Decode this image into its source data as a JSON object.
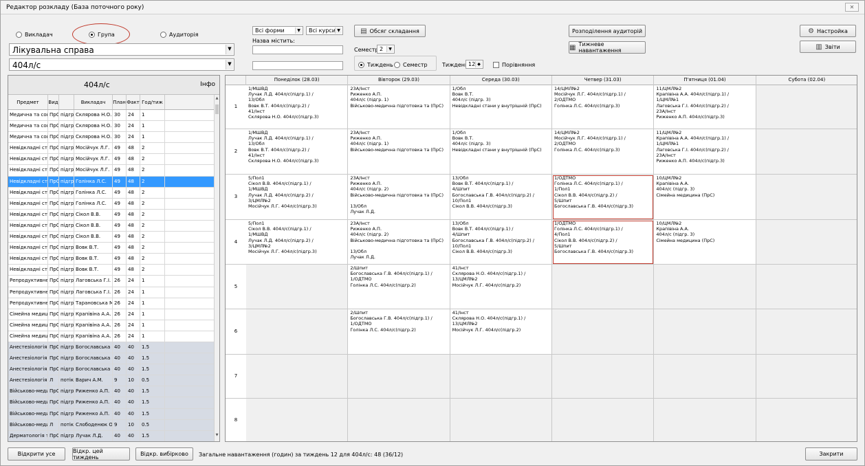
{
  "window": {
    "title": "Редактор розкладу (База поточного року)",
    "close_glyph": "✕"
  },
  "mode": {
    "options": [
      "Викладач",
      "Група",
      "Аудиторія"
    ],
    "selected": "Група"
  },
  "specialty_combo": {
    "value": "Лікувальна справа"
  },
  "group_combo": {
    "value": "404л/с"
  },
  "filters": {
    "forms": "Всі форми",
    "courses": "Всі курси",
    "city_label": "Назва містить:",
    "city_value": "",
    "second_value": ""
  },
  "buttons": {
    "volume": "Обсяг складання",
    "distribution": "Розподілення аудиторій",
    "weekly_load": "Тижневе навантаження",
    "settings": "Настройка",
    "reports": "Звіти",
    "open_all": "Відкрити усе",
    "open_week": "Відкр. цей тиждень",
    "open_selective": "Відкр. вибірково",
    "close": "Закрити"
  },
  "semester": {
    "label": "Семестр",
    "value": "2"
  },
  "view": {
    "week_label": "Тиждень",
    "semester_label": "Семестр",
    "selected": "Тиждень",
    "week_num_label": "Тиждень",
    "week_num": "12",
    "compare_label": "Порівняння"
  },
  "left_table": {
    "group": "404л/с",
    "info": "Інфо",
    "headers": [
      "Предмет",
      "Вид",
      "",
      "Викладач",
      "План",
      "Факт",
      "Год/тиж"
    ],
    "rows": [
      [
        "Медична та соціальна р",
        "ПрС",
        "підгр. 1",
        "Склярова Н.О.",
        "30",
        "24",
        "1"
      ],
      [
        "Медична та соціальна р",
        "ПрС",
        "підгр. 2",
        "Склярова Н.О.",
        "30",
        "24",
        "1"
      ],
      [
        "Медична та соціальна р",
        "ПрС",
        "підгр. 3",
        "Склярова Н.О.",
        "30",
        "24",
        "1"
      ],
      [
        "Невідкладні стани в ак",
        "ПрС",
        "підгр. 1",
        "Мосійчук Л.Г.",
        "49",
        "48",
        "2"
      ],
      [
        "Невідкладні стани в ак",
        "ПрС",
        "підгр. 2",
        "Мосійчук Л.Г.",
        "49",
        "48",
        "2"
      ],
      [
        "Невідкладні стани в ак",
        "ПрС",
        "підгр. 3",
        "Мосійчук Л.Г.",
        "49",
        "48",
        "2"
      ],
      [
        "Невідкладні стани в пе",
        "ПрС",
        "підгр. 1",
        "Голінка Л.С.",
        "49",
        "48",
        "2"
      ],
      [
        "Невідкладні стани в пе",
        "ПрС",
        "підгр. 2",
        "Голінка Л.С.",
        "49",
        "48",
        "2"
      ],
      [
        "Невідкладні стани в пе",
        "ПрС",
        "підгр. 3",
        "Голінка Л.С.",
        "49",
        "48",
        "2"
      ],
      [
        "Невідкладні стани в хір",
        "ПрС",
        "підгр. 1",
        "Сікол В.В.",
        "49",
        "48",
        "2"
      ],
      [
        "Невідкладні стани в хір",
        "ПрС",
        "підгр. 2",
        "Сікол В.В.",
        "49",
        "48",
        "2"
      ],
      [
        "Невідкладні стани в хір",
        "ПрС",
        "підгр. 3",
        "Сікол В.В.",
        "49",
        "48",
        "2"
      ],
      [
        "Невідкладні стани у вну",
        "ПрС",
        "підгр. 1",
        "Вовк В.Т.",
        "49",
        "48",
        "2"
      ],
      [
        "Невідкладні стани у вну",
        "ПрС",
        "підгр. 2",
        "Вовк В.Т.",
        "49",
        "48",
        "2"
      ],
      [
        "Невідкладні стани у вну",
        "ПрС",
        "підгр. 3",
        "Вовк В.Т.",
        "49",
        "48",
        "2"
      ],
      [
        "Репродуктивне здоров",
        "ПрС",
        "підгр. 2",
        "Лаговська Г.І.",
        "26",
        "24",
        "1"
      ],
      [
        "Репродуктивне здоров",
        "ПрС",
        "підгр. 3",
        "Лаговська Г.І.",
        "26",
        "24",
        "1"
      ],
      [
        "Репродуктивне здоров",
        "ПрС",
        "підгр. 1",
        "Тарановська М.І.",
        "26",
        "24",
        "1"
      ],
      [
        "Сімейна медицина",
        "ПрС",
        "підгр. 1",
        "Крапівіна А.А.",
        "26",
        "24",
        "1"
      ],
      [
        "Сімейна медицина",
        "ПрС",
        "підгр. 2",
        "Крапівіна А.А.",
        "26",
        "24",
        "1"
      ],
      [
        "Сімейна медицина",
        "ПрС",
        "підгр. 3",
        "Крапівіна А.А.",
        "26",
        "24",
        "1"
      ],
      [
        "Анестезіологія і реанім",
        "ПрС",
        "підгр. 1",
        "Богославська Г.В.",
        "40",
        "40",
        "1.5"
      ],
      [
        "Анестезіологія і реанім",
        "ПрС",
        "підгр. 2",
        "Богославська Г.В.",
        "40",
        "40",
        "1.5"
      ],
      [
        "Анестезіологія і реанім",
        "ПрС",
        "підгр. 3",
        "Богославська Г.В.",
        "40",
        "40",
        "1.5"
      ],
      [
        "Анестезіологія і реанім",
        "Л",
        "потік",
        "Варич А.М.",
        "9",
        "10",
        "0.5"
      ],
      [
        "Військово-медична підг",
        "ПрС",
        "підгр. 1",
        "Риженко А.П.",
        "40",
        "40",
        "1.5"
      ],
      [
        "Військово-медична підг",
        "ПрС",
        "підгр. 2",
        "Риженко А.П.",
        "40",
        "40",
        "1.5"
      ],
      [
        "Військово-медична підг",
        "ПрС",
        "підгр. 3",
        "Риженко А.П.",
        "40",
        "40",
        "1.5"
      ],
      [
        "Військово-медична підг",
        "Л",
        "потік",
        "Слободенюк О.Л.",
        "9",
        "10",
        "0.5"
      ],
      [
        "Дерматологія та венер",
        "ПрС",
        "підгр. 1",
        "Лучак Л.Д.",
        "40",
        "40",
        "1.5"
      ]
    ]
  },
  "schedule": {
    "days": [
      "Понеділок (28.03)",
      "Вівторок (29.03)",
      "Середа (30.03)",
      "Четвер (31.03)",
      "П'ятниця (01.04)",
      "Субота (02.04)"
    ],
    "slots": [
      "1",
      "2",
      "3",
      "4",
      "5",
      "6",
      "7",
      "8"
    ],
    "cells": [
      [
        "1/МШВД\nЛучак Л.Д. 404л/с(підгр.1) /\n13/Обл\nВовк В.Т. 404л/с(підгр.2) /\n41/Інст\nСклярова Н.О. 404л/с(підгр.3)",
        "23А/Інст\nРиженко А.П.\n404л/с (підгр. 1)\nВійськово-медична підготовка та (ПрС)",
        "1/Обл\nВовк В.Т.\n404л/с (підгр. 3)\nНевідкладні стани у внутрішній (ПрС)",
        "14/ЦМЛ№2\nМосійчук Л.Г. 404л/с(підгр.1) /\n2/ОДТМО\nГолінка Л.С. 404л/с(підгр.3)",
        "11/ЦМЛ№2\nКрапівіна А.А. 404л/с(підгр.1) /\n1/ЦМЛ№1\nЛаговська Г.І. 404л/с(підгр.2) /\n23А/Інст\nРиженко А.П. 404л/с(підгр.3)",
        ""
      ],
      [
        "1/МШВД\nЛучак Л.Д. 404л/с(підгр.1) /\n13/Обл\nВовк В.Т. 404л/с(підгр.2) /\n41/Інст\nСклярова Н.О. 404л/с(підгр.3)",
        "23А/Інст\nРиженко А.П.\n404л/с (підгр. 1)\nВійськово-медична підготовка та (ПрС)",
        "1/Обл\nВовк В.Т.\n404л/с (підгр. 3)\nНевідкладні стани у внутрішній (ПрС)",
        "14/ЦМЛ№2\nМосійчук Л.Г. 404л/с(підгр.1) /\n2/ОДТМО\nГолінка Л.С. 404л/с(підгр.3)",
        "11/ЦМЛ№2\nКрапівіна А.А. 404л/с(підгр.1) /\n1/ЦМЛ№1\nЛаговська Г.І. 404л/с(підгр.2) /\n23А/Інст\nРиженко А.П. 404л/с(підгр.3)",
        ""
      ],
      [
        "5/Пол1\nСікол В.В. 404л/с(підгр.1) /\n1/МШВД\nЛучак Л.Д. 404л/с(підгр.2) /\n3/ЦМЛ№2\nМосійчук Л.Г. 404л/с(підгр.3)",
        "23А/Інст\nРиженко А.П.\n404л/с (підгр. 2)\nВійськово-медична підготовка та (ПрС)\n\n13/Обл\nЛучак Л.Д.",
        "13/Обл\nВовк В.Т. 404л/с(підгр.1) /\n4/Шпит\nБогославська Г.В. 404л/с(підгр.2) /\n10/Пол1\nСікол В.В. 404л/с(підгр.3)",
        "1/ОДТМО\nГолінка Л.С. 404л/с(підгр.1) /\n1/Пол1\nСікол В.В. 404л/с(підгр.2) /\n5/Шпит\nБогославська Г.В. 404л/с(підгр.3)",
        "10/ЦМЛ№2\nКрапівіна А.А.\n404л/с (підгр. 3)\nСімейна медицина (ПрС)",
        ""
      ],
      [
        "5/Пол1\nСікол В.В. 404л/с(підгр.1) /\n1/МШВД\nЛучак Л.Д. 404л/с(підгр.2) /\n3/ЦМЛ№2\nМосійчук Л.Г. 404л/с(підгр.3)",
        "23А/Інст\nРиженко А.П.\n404л/с (підгр. 2)\nВійськово-медична підготовка та (ПрС)\n\n13/Обл\nЛучак Л.Д.",
        "13/Обл\nВовк В.Т. 404л/с(підгр.1) /\n4/Шпит\nБогославська Г.В. 404л/с(підгр.2) /\n10/Пол1\nСікол В.В. 404л/с(підгр.3)",
        "1/ОДТМО\nГолінка Л.С. 404л/с(підгр.1) /\n4/Пол1\nСікол В.В. 404л/с(підгр.2) /\n5/Шпит\nБогославська Г.В. 404л/с(підгр.3)",
        "10/ЦМЛ№2\nКрапівіна А.А.\n404л/с (підгр. 3)\nСімейна медицина (ПрС)",
        ""
      ],
      [
        "",
        "2/Шпит\nБогославська Г.В. 404л/с(підгр.1) /\n1/ОДТМО\nГолінка Л.С. 404л/с(підгр.2)",
        "41/Інст\nСклярова Н.О. 404л/с(підгр.1) /\n13/ЦМЛ№2\nМосійчук Л.Г. 404л/с(підгр.2)",
        "",
        "",
        ""
      ],
      [
        "",
        "2/Шпит\nБогославська Г.В. 404л/с(підгр.1) /\n1/ОДТМО\nГолінка Л.С. 404л/с(підгр.2)",
        "41/Інст\nСклярова Н.О. 404л/с(підгр.1) /\n13/ЦМЛ№2\nМосійчук Л.Г. 404л/с(підгр.2)",
        "",
        "",
        ""
      ],
      [
        "",
        "",
        "",
        "",
        "",
        ""
      ],
      [
        "",
        "",
        "",
        "",
        "",
        ""
      ]
    ]
  },
  "status": "Загальне навантаження (годин) за тиждень 12 для 404л/с: 48 (36/12)",
  "colors": {
    "selected_row": "#3399ff",
    "grey_row": "#d6dbe4",
    "highlight_red": "#c0392b"
  }
}
